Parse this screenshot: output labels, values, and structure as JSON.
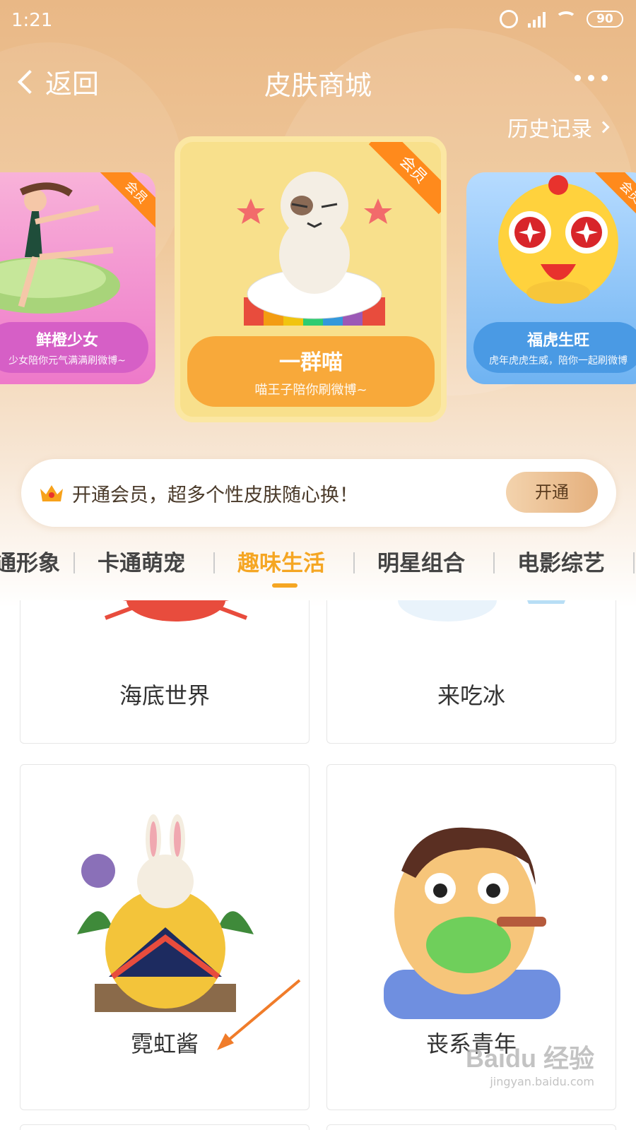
{
  "status_bar": {
    "time": "1:21",
    "battery": "90"
  },
  "nav": {
    "back_label": "返回",
    "title": "皮肤商城",
    "history_label": "历史记录"
  },
  "carousel": [
    {
      "title": "鲜橙少女",
      "subtitle": "少女陪你元气满满刷微博~",
      "badge": "会员",
      "color": "#d65fc6"
    },
    {
      "title": "一群喵",
      "subtitle": "喵王子陪你刷微博~",
      "badge": "会员",
      "color": "#f8a93a"
    },
    {
      "title": "福虎生旺",
      "subtitle": "虎年虎虎生威，陪你一起刷微博",
      "badge": "会员",
      "color": "#4a9ae4"
    }
  ],
  "member_banner": {
    "text": "开通会员，超多个性皮肤随心换！",
    "button": "开通"
  },
  "tabs": [
    {
      "label": "通形象"
    },
    {
      "label": "卡通萌宠"
    },
    {
      "label": "趣味生活",
      "active": true
    },
    {
      "label": "明星组合"
    },
    {
      "label": "电影综艺"
    }
  ],
  "grid": [
    {
      "label": "海底世界"
    },
    {
      "label": "来吃冰"
    },
    {
      "label": "霓虹酱"
    },
    {
      "label": "丧系青年"
    }
  ],
  "watermark": {
    "brand": "Baidu 经验",
    "url": "jingyan.baidu.com"
  },
  "colors": {
    "accent": "#f5a623",
    "hero": "#e9b886"
  }
}
